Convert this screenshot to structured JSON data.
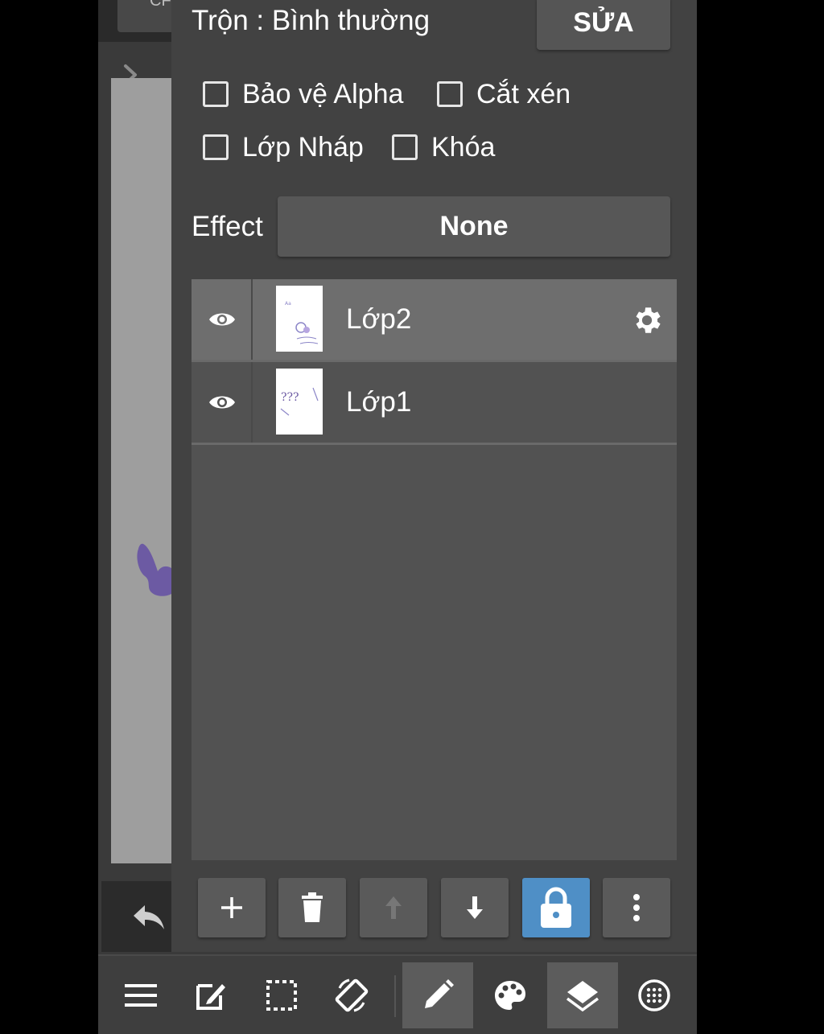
{
  "canvas": {
    "tab_fragment": "CF"
  },
  "layer_props": {
    "blend_label": "Trộn : Bình thường",
    "edit_button": "SỬA",
    "checkboxes": [
      {
        "label": "Bảo vệ Alpha",
        "checked": false
      },
      {
        "label": "Cắt xén",
        "checked": false
      },
      {
        "label": "Lớp Nháp",
        "checked": false
      },
      {
        "label": "Khóa",
        "checked": false
      }
    ],
    "effect_label": "Effect",
    "effect_value": "None"
  },
  "layers": [
    {
      "name": "Lớp2",
      "visible": true,
      "selected": true,
      "thumb_text": "???"
    },
    {
      "name": "Lớp1",
      "visible": true,
      "selected": false,
      "thumb_text": "???"
    }
  ],
  "layer_toolbar": {
    "buttons": [
      "add-icon",
      "trash-icon",
      "arrow-up-icon",
      "arrow-down-icon",
      "lock-icon",
      "more-vertical-icon"
    ],
    "active": "lock-icon",
    "accent": "#4f8fc6"
  },
  "bottom_nav": {
    "items": [
      "menu-icon",
      "edit-icon",
      "selection-icon",
      "rotate-icon",
      "pencil-icon",
      "palette-icon",
      "layers-icon",
      "grid-icon"
    ],
    "highlighted": [
      "pencil-icon",
      "layers-icon"
    ]
  }
}
